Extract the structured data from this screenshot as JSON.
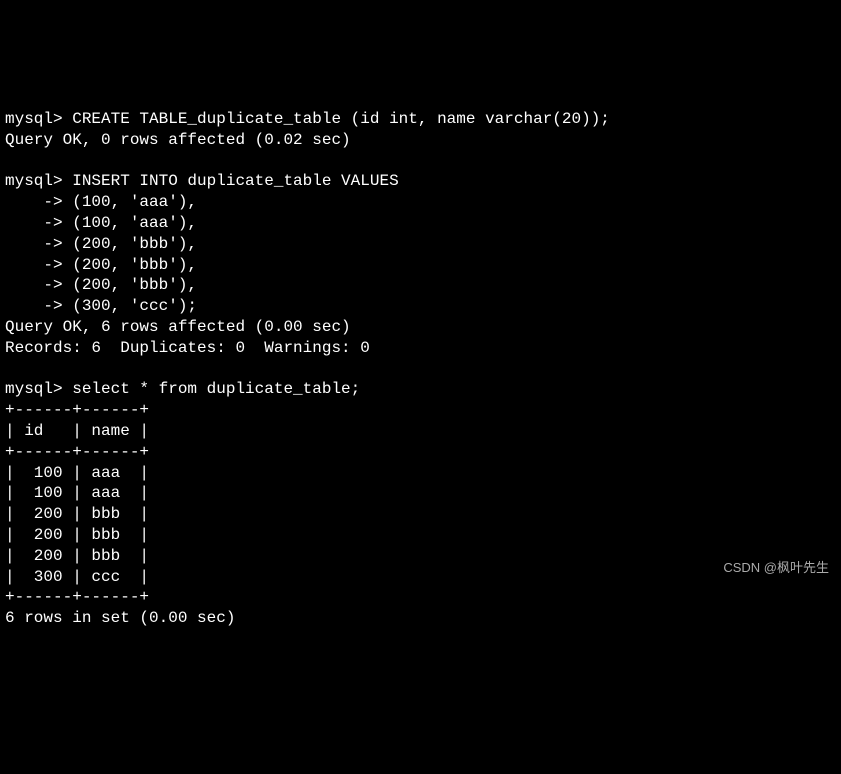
{
  "lines": {
    "l1": "mysql> CREATE TABLE_duplicate_table (id int, name varchar(20));",
    "l2": "Query OK, 0 rows affected (0.02 sec)",
    "l3": "",
    "l4": "mysql> INSERT INTO duplicate_table VALUES",
    "l5": "    -> (100, 'aaa'),",
    "l6": "    -> (100, 'aaa'),",
    "l7": "    -> (200, 'bbb'),",
    "l8": "    -> (200, 'bbb'),",
    "l9": "    -> (200, 'bbb'),",
    "l10": "    -> (300, 'ccc');",
    "l11": "Query OK, 6 rows affected (0.00 sec)",
    "l12": "Records: 6  Duplicates: 0  Warnings: 0",
    "l13": "",
    "l14": "mysql> select * from duplicate_table;",
    "l15": "+------+------+",
    "l16": "| id   | name |",
    "l17": "+------+------+",
    "l18": "|  100 | aaa  |",
    "l19": "|  100 | aaa  |",
    "l20": "|  200 | bbb  |",
    "l21": "|  200 | bbb  |",
    "l22": "|  200 | bbb  |",
    "l23": "|  300 | ccc  |",
    "l24": "+------+------+",
    "l25": "6 rows in set (0.00 sec)"
  },
  "watermark": "CSDN @枫叶先生"
}
